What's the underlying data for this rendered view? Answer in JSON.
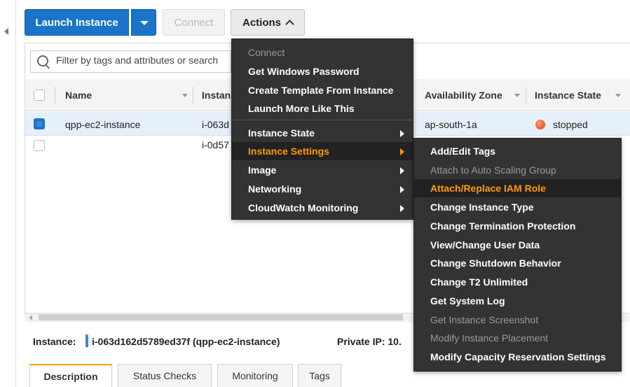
{
  "toolbar": {
    "launch_label": "Launch Instance",
    "connect_label": "Connect",
    "actions_label": "Actions"
  },
  "filter": {
    "placeholder": "Filter by tags and attributes or search"
  },
  "table": {
    "headers": [
      "Name",
      "Instan",
      "Availability Zone",
      "Instance State"
    ],
    "rows": [
      {
        "name": "qpp-ec2-instance",
        "id": "i-063d",
        "zone": "ap-south-1a",
        "state": "stopped",
        "selected": true
      },
      {
        "name": "",
        "id": "i-0d57",
        "zone": "",
        "state": "",
        "selected": false
      }
    ]
  },
  "actions_menu": {
    "items": [
      {
        "label": "Connect",
        "disabled": true
      },
      {
        "label": "Get Windows Password"
      },
      {
        "label": "Create Template From Instance"
      },
      {
        "label": "Launch More Like This"
      },
      {
        "label": "Instance State",
        "submenu": true
      },
      {
        "label": "Instance Settings",
        "submenu": true,
        "highlighted": true
      },
      {
        "label": "Image",
        "submenu": true
      },
      {
        "label": "Networking",
        "submenu": true
      },
      {
        "label": "CloudWatch Monitoring",
        "submenu": true
      }
    ]
  },
  "settings_menu": {
    "items": [
      {
        "label": "Add/Edit Tags"
      },
      {
        "label": "Attach to Auto Scaling Group",
        "disabled": true
      },
      {
        "label": "Attach/Replace IAM Role",
        "highlighted": true
      },
      {
        "label": "Change Instance Type"
      },
      {
        "label": "Change Termination Protection"
      },
      {
        "label": "View/Change User Data"
      },
      {
        "label": "Change Shutdown Behavior"
      },
      {
        "label": "Change T2 Unlimited"
      },
      {
        "label": "Get System Log"
      },
      {
        "label": "Get Instance Screenshot",
        "disabled": true
      },
      {
        "label": "Modify Instance Placement",
        "disabled": true
      },
      {
        "label": "Modify Capacity Reservation Settings"
      }
    ]
  },
  "details": {
    "instance_label": "Instance:",
    "instance_value": "i-063d162d5789ed37f (qpp-ec2-instance)",
    "private_ip_label": "Private IP: 10."
  },
  "tabs": [
    "Description",
    "Status Checks",
    "Monitoring",
    "Tags"
  ],
  "colors": {
    "primary": "#1a74c9",
    "highlight": "#ff9900",
    "menu_bg": "#333333",
    "stopped": "#e2401b"
  }
}
